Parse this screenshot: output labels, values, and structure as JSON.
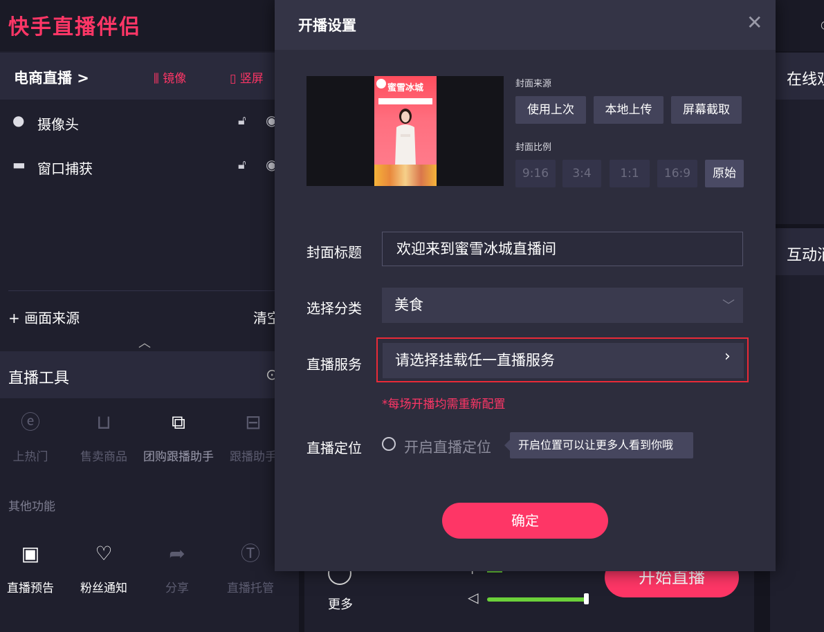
{
  "app": {
    "name": "快手直播伴侣"
  },
  "left": {
    "mode_label": "电商直播 >",
    "mirror_label": "镜像",
    "vertical_label": "竖屏",
    "sources": [
      {
        "label": "摄像头"
      },
      {
        "label": "窗口捕获"
      }
    ],
    "add_source": "+ 画面来源",
    "clear": "清空",
    "tools_title": "直播工具",
    "tools": [
      {
        "label": "上热门",
        "icon": "fire-plus-icon"
      },
      {
        "label": "售卖商品",
        "icon": "cart-icon"
      },
      {
        "label": "团购跟播助手",
        "icon": "video-camera-icon"
      },
      {
        "label": "跟播助手",
        "icon": "assistant-icon"
      }
    ],
    "other_title": "其他功能",
    "other_tools": [
      {
        "label": "直播预告",
        "icon": "calendar-play-icon"
      },
      {
        "label": "粉丝通知",
        "icon": "heart-chat-icon"
      },
      {
        "label": "分享",
        "icon": "share-icon"
      },
      {
        "label": "直播托管",
        "icon": "hosting-icon"
      }
    ]
  },
  "right": {
    "online_title": "在线观众",
    "interact_title": "互动消息"
  },
  "bottom": {
    "more_label": "更多",
    "start_label": "开始直播",
    "volume_fraction": 0.97
  },
  "modal": {
    "title": "开播设置",
    "cover_source_label": "封面来源",
    "cover_source_buttons": [
      "使用上次",
      "本地上传",
      "屏幕截取"
    ],
    "cover_ratio_label": "封面比例",
    "cover_ratios": [
      "9:16",
      "3:4",
      "1:1",
      "16:9",
      "原始"
    ],
    "cover_ratio_selected": "原始",
    "poster": {
      "brand": "蜜雪冰城"
    },
    "cover_title_label": "封面标题",
    "cover_title_value": "欢迎来到蜜雪冰城直播间",
    "category_label": "选择分类",
    "category_value": "美食",
    "service_label": "直播服务",
    "service_placeholder": "请选择挂载任一直播服务",
    "service_note": "*每场开播均需重新配置",
    "location_label": "直播定位",
    "location_option": "开启直播定位",
    "location_tip": "开启位置可以让更多人看到你哦",
    "confirm": "确定"
  },
  "colors": {
    "accent": "#fe3666",
    "highlight_border": "#ea2a37",
    "volume": "#6bd03a"
  }
}
